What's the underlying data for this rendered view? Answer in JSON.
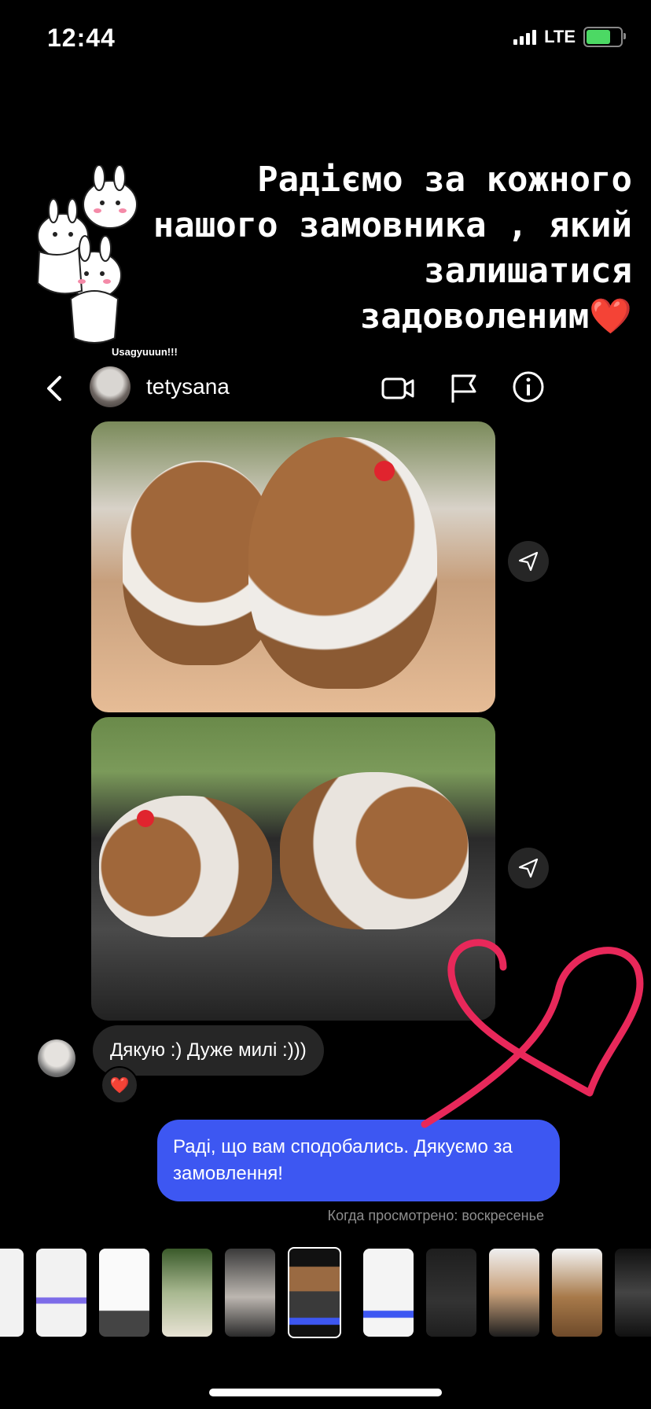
{
  "status_bar": {
    "time": "12:44",
    "network": "LTE"
  },
  "story": {
    "caption_lines": [
      "Радіємо за кожного",
      "нашого замовника , який",
      "залишатися",
      "задоволеним"
    ],
    "caption_emoji": "❤️",
    "sticker_label": "Usagyuuun!!!"
  },
  "chat": {
    "username": "tetysana",
    "received_message": "Дякую :) Дуже милі :)))",
    "reaction": "❤️",
    "sent_message": "Раді, що вам сподобались. Дякуємо за замовлення!",
    "seen_status": "Когда просмотрено: воскресенье"
  },
  "colors": {
    "sent_bubble": "#3d57f2",
    "received_bubble": "#262626",
    "heart_drawing": "#e8285a",
    "battery": "#4cd964"
  },
  "icons": [
    "back-icon",
    "video-call-icon",
    "flag-icon",
    "info-icon",
    "share-icon",
    "heart-icon"
  ]
}
